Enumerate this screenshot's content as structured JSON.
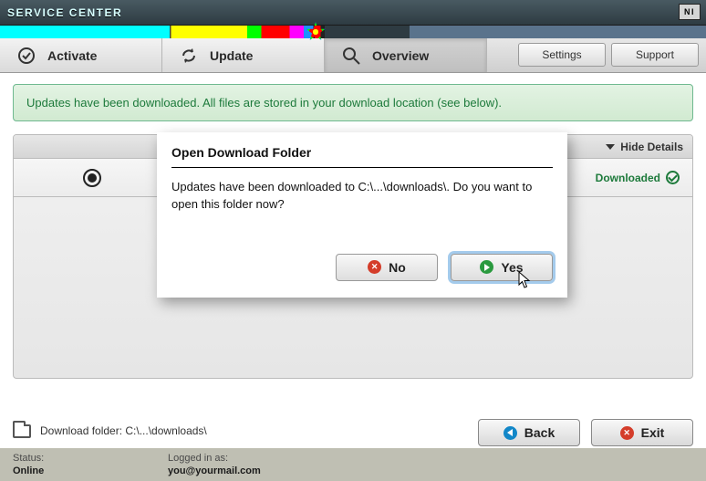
{
  "app": {
    "title": "SERVICE CENTER",
    "logo": "NI"
  },
  "tabs": {
    "activate": "Activate",
    "update": "Update",
    "overview": "Overview"
  },
  "rightButtons": {
    "settings": "Settings",
    "support": "Support"
  },
  "banner": "Updates have been downloaded. All files are stored in your download location (see below).",
  "panel": {
    "hideDetails": "Hide Details",
    "downloadedLabel": "Downloaded"
  },
  "footer": {
    "folderLabel": "Download folder: C:\\...\\downloads\\",
    "back": "Back",
    "exit": "Exit"
  },
  "status": {
    "statusLabel": "Status:",
    "statusValue": "Online",
    "loggedLabel": "Logged in as:",
    "loggedValue": "you@yourmail.com"
  },
  "dialog": {
    "title": "Open Download Folder",
    "body": "Updates have been downloaded to C:\\...\\downloads\\. Do you want to open this folder now?",
    "no": "No",
    "yes": "Yes"
  }
}
